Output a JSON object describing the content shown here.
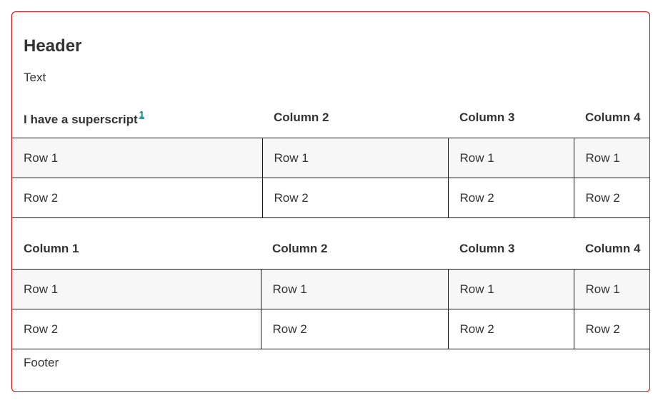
{
  "card": {
    "title": "Header",
    "text": "Text",
    "footer": "Footer"
  },
  "tables": [
    {
      "columns": [
        "I have a superscript",
        "Column 2",
        "Column 3",
        "Column 4"
      ],
      "superscript": "1",
      "rows": [
        [
          "Row 1",
          "Row 1",
          "Row 1",
          "Row 1"
        ],
        [
          "Row 2",
          "Row 2",
          "Row 2",
          "Row 2"
        ]
      ]
    },
    {
      "columns": [
        "Column 1",
        "Column 2",
        "Column 3",
        "Column 4"
      ],
      "rows": [
        [
          "Row 1",
          "Row 1",
          "Row 1",
          "Row 1"
        ],
        [
          "Row 2",
          "Row 2",
          "Row 2",
          "Row 2"
        ]
      ]
    }
  ],
  "colors": {
    "card_border": "#cc0000",
    "table_border": "#0000cc",
    "link": "#00806e",
    "shaded_row": "#f7f7f7"
  }
}
